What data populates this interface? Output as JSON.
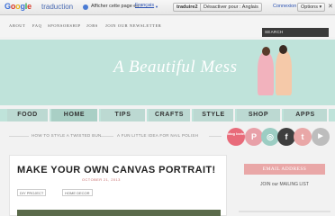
{
  "translate_bar": {
    "logo": [
      "G",
      "o",
      "o",
      "g",
      "l",
      "e"
    ],
    "brand": "traduction",
    "text": "Afficher cette page en :",
    "language": "Français",
    "translate_label": "traduire2",
    "disable_label": "Désactiver pour : Anglais",
    "connexion": "Connexion",
    "options": "Options"
  },
  "top_nav": {
    "items": [
      "ABOUT",
      "FAQ",
      "SPONSORSHIP",
      "JOBS",
      "JOIN OUR NEWSLETTER"
    ],
    "search": "SEARCH"
  },
  "banner": {
    "logo": "A Beautiful Mess"
  },
  "categories": [
    "FOOD",
    "HOME",
    "TIPS",
    "CRAFTS",
    "STYLE",
    "SHOP",
    "APPS"
  ],
  "sub_bar": {
    "prev": "HOW TO STYLE A TWISTED BUN",
    "next": "A FUN LITTLE IDEA FOR NAIL POLISH"
  },
  "social": [
    {
      "name": "bloglovin",
      "label": "blog lovin",
      "color": "#e86b7a"
    },
    {
      "name": "pinterest",
      "label": "P",
      "color": "#e8a0a8"
    },
    {
      "name": "instagram",
      "label": "◎",
      "color": "#9ccdc3"
    },
    {
      "name": "facebook",
      "label": "f",
      "color": "#3e3e3e"
    },
    {
      "name": "twitter",
      "label": "t",
      "color": "#e9a7a7"
    },
    {
      "name": "youtube",
      "label": "▶",
      "color": "#bdbdbd"
    }
  ],
  "post": {
    "title": "MAKE YOUR OWN CANVAS PORTRAIT!",
    "date": "OCTOBER 21, 2013",
    "tags": [
      "DIY PROJECT",
      "HOME DECOR"
    ]
  },
  "sidebar": {
    "email_label": "EMAIL ADDRESS",
    "join_text": "JOIN our MAILING LIST"
  }
}
